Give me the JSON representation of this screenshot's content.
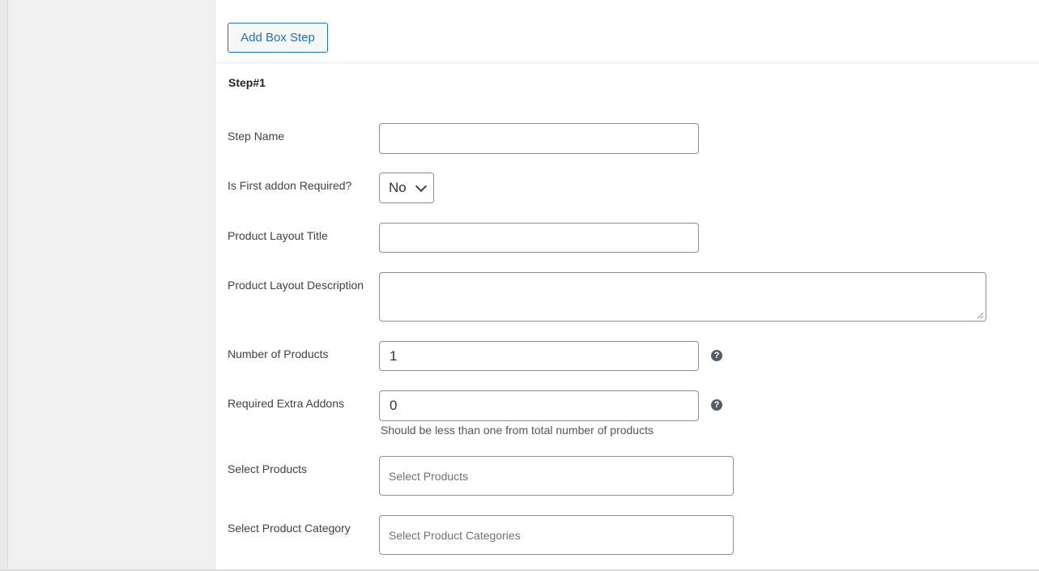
{
  "toolbar": {
    "add_step_label": "Add Box Step"
  },
  "step": {
    "title": "Step#1",
    "fields": {
      "step_name": {
        "label": "Step Name",
        "value": ""
      },
      "first_addon_required": {
        "label": "Is First addon Required?",
        "selected": "No"
      },
      "product_layout_title": {
        "label": "Product Layout Title",
        "value": ""
      },
      "product_layout_description": {
        "label": "Product Layout Description",
        "value": ""
      },
      "number_of_products": {
        "label": "Number of Products",
        "value": "1",
        "help_icon": "question-circle-icon"
      },
      "required_extra_addons": {
        "label": "Required Extra Addons",
        "value": "0",
        "help_icon": "question-circle-icon",
        "hint": "Should be less than one from total number of products"
      },
      "select_products": {
        "label": "Select Products",
        "placeholder": "Select Products"
      },
      "select_product_category": {
        "label": "Select Product Category",
        "placeholder": "Select Product Categories"
      }
    }
  },
  "colors": {
    "accent": "#2271b1",
    "field_border": "#8c8f94",
    "help_icon": "#555d66"
  }
}
